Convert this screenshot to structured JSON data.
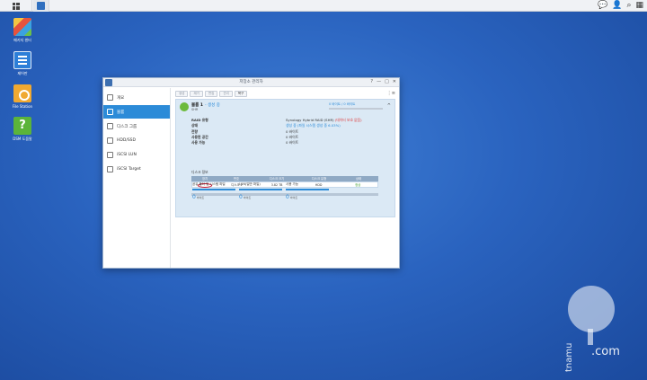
{
  "taskbar": {
    "right_icons": [
      "chat-icon",
      "user-icon",
      "search-icon",
      "widgets-icon"
    ],
    "right_glyphs": [
      "💬",
      "👤",
      "⌕",
      "▦"
    ]
  },
  "desktop": {
    "icons": [
      {
        "label": "패키지 센터",
        "icon": "package-center-icon"
      },
      {
        "label": "제어판",
        "icon": "control-panel-icon"
      },
      {
        "label": "File Station",
        "icon": "file-station-icon"
      },
      {
        "label": "DSM 도움말",
        "icon": "help-icon"
      }
    ]
  },
  "window": {
    "title": "저장소 관리자",
    "controls": [
      "?",
      "—",
      "□",
      "✕"
    ],
    "sidebar": [
      {
        "label": "개요",
        "icon": "overview-icon",
        "active": false
      },
      {
        "label": "볼륨",
        "icon": "volume-icon",
        "active": true
      },
      {
        "label": "디스크 그룹",
        "icon": "disk-group-icon",
        "active": false
      },
      {
        "label": "HDD/SSD",
        "icon": "hdd-icon",
        "active": false
      },
      {
        "label": "iSCSI LUN",
        "icon": "iscsi-lun-icon",
        "active": false
      },
      {
        "label": "iSCSI Target",
        "icon": "iscsi-target-icon",
        "active": false
      }
    ],
    "toolbar": {
      "buttons": [
        {
          "label": "생성",
          "enabled": false
        },
        {
          "label": "제거",
          "enabled": false
        },
        {
          "label": "편집",
          "enabled": false
        },
        {
          "label": "관리",
          "enabled": false
        },
        {
          "label": "복구",
          "enabled": true
        }
      ],
      "menu_glyph": "⋮≡"
    },
    "volume": {
      "title": "볼륨 1",
      "status": "- 생성 중",
      "type": "SHR",
      "usage_text": "0 바이트 / 0 바이트",
      "usage_fraction": 0.0,
      "collapse_glyph": "^",
      "properties": [
        {
          "key": "RAID 유형",
          "value": "Synology Hybrid RAID (SHR)",
          "extra": "(데이터 보호 없음)"
        },
        {
          "key": "상태",
          "value": "생성 중 (파일 시스템 생성 중 6.03%)",
          "link": true
        },
        {
          "key": "전량",
          "value": "0 바이트"
        },
        {
          "key": "사용된 공간",
          "value": "0 바이트"
        },
        {
          "key": "사용 가능",
          "value": "0 바이트"
        }
      ],
      "disk_info_title": "디스크 정보",
      "disk_table": {
        "headers": [
          "장치",
          "번호",
          "디스크 크기",
          "디스크 유형",
          "상태"
        ],
        "rows": [
          {
            "device": "",
            "number": "디스크 2",
            "size": "3.82 TB",
            "type": "HDD",
            "status": "정상"
          }
        ]
      }
    },
    "summary": [
      {
        "label": "공유 폴더 및 시스템 파일",
        "value": "0",
        "unit": "바이트"
      },
      {
        "label": "LUN(일반 파일)",
        "value": "0",
        "unit": "바이트"
      },
      {
        "label": "사용 가능",
        "value": "0",
        "unit": "바이트"
      }
    ]
  },
  "watermark": {
    "vertical_text": "tnamu",
    "suffix": ".com"
  }
}
